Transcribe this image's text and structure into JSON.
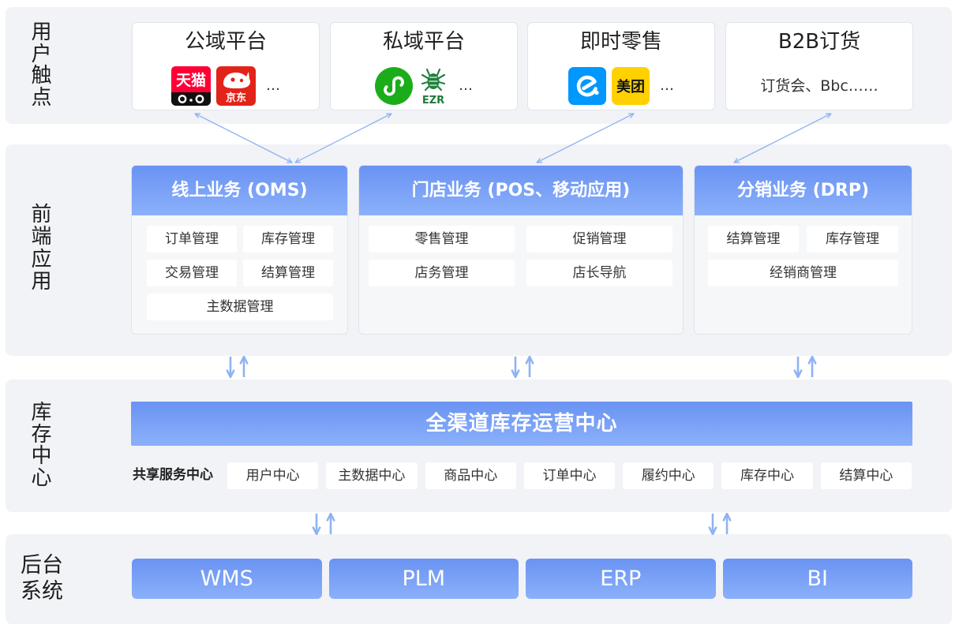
{
  "touchpoints": {
    "label": "用户触点",
    "cards": [
      {
        "title": "公域平台",
        "logos": [
          {
            "icon": "tmall-logo-icon",
            "text": "天猫"
          },
          {
            "icon": "jd-logo-icon",
            "text": "京东"
          }
        ],
        "more": "…"
      },
      {
        "title": "私域平台",
        "logos": [
          {
            "icon": "wechat-mini-program-icon"
          },
          {
            "icon": "ezr-logo-icon",
            "text": "EZR"
          }
        ],
        "more": "…"
      },
      {
        "title": "即时零售",
        "logos": [
          {
            "icon": "eleme-logo-icon"
          },
          {
            "icon": "meituan-logo-icon",
            "text": "美团"
          }
        ],
        "more": "…"
      },
      {
        "title": "B2B订货",
        "text": "订货会、Bbc……"
      }
    ]
  },
  "frontend": {
    "label": "前端应用",
    "modules": [
      {
        "title": "线上业务 (OMS)",
        "items": [
          "订单管理",
          "库存管理",
          "交易管理",
          "结算管理",
          "主数据管理"
        ]
      },
      {
        "title": "门店业务 (POS、移动应用)",
        "items": [
          "零售管理",
          "促销管理",
          "店务管理",
          "店长导航"
        ]
      },
      {
        "title": "分销业务 (DRP)",
        "items": [
          "结算管理",
          "库存管理",
          "经销商管理"
        ]
      }
    ]
  },
  "inventory": {
    "label": "库存中心",
    "banner": "全渠道库存运营中心",
    "shared_label": "共享服务中心",
    "services": [
      "用户中心",
      "主数据中心",
      "商品中心",
      "订单中心",
      "履约中心",
      "库存中心",
      "结算中心"
    ]
  },
  "backend": {
    "label": "后台系统",
    "systems": [
      "WMS",
      "PLM",
      "ERP",
      "BI"
    ]
  },
  "colors": {
    "layer_bg": "#f1f3f6",
    "card_border": "#e0e5eb",
    "accent_top": "#6a93f3",
    "accent_bottom": "#8bb0fa",
    "connector": "#8fb3f3"
  }
}
